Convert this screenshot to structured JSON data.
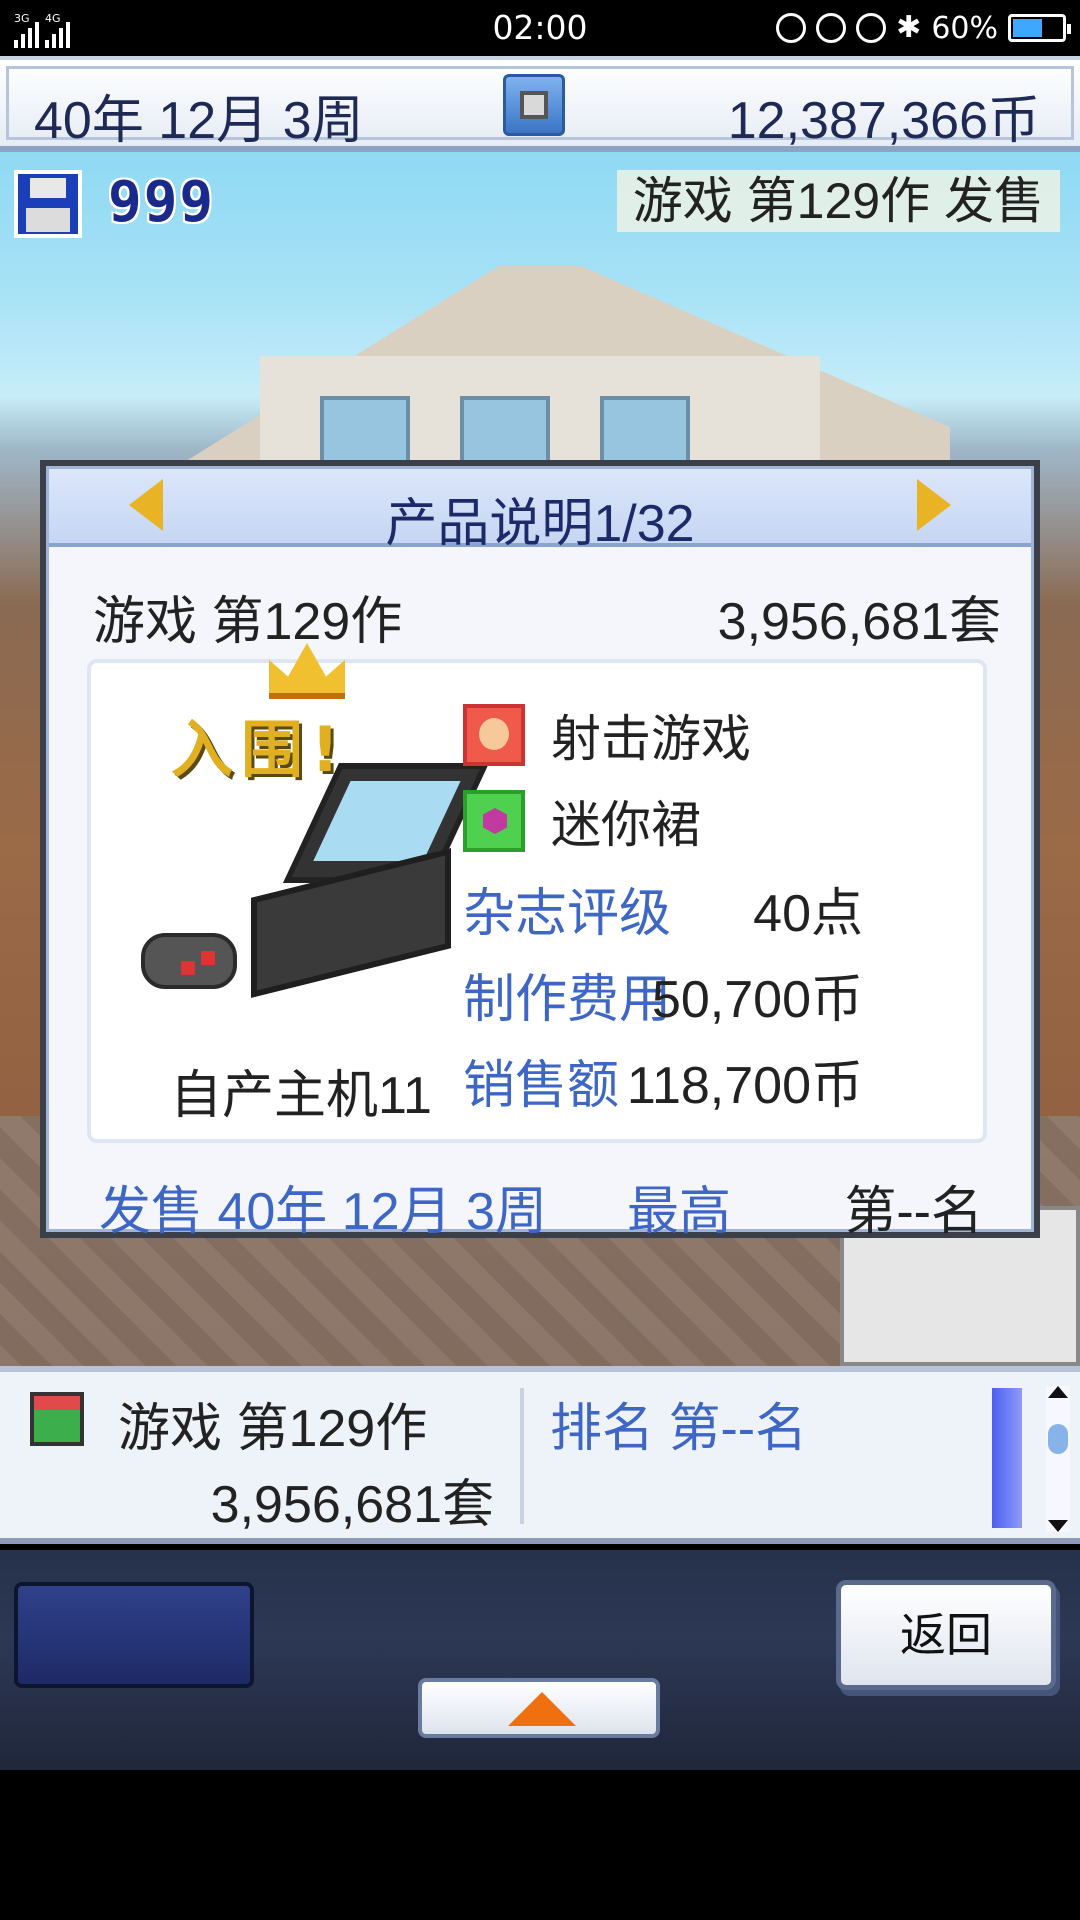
{
  "status_bar": {
    "signal1_tag": "3G",
    "signal2_tag": "4G",
    "time": "02:00",
    "battery_text": "60%",
    "battery_level": 0.6,
    "icons": [
      "mute-icon",
      "rotation-lock-icon",
      "alarm-icon",
      "bluetooth-icon",
      "battery-icon"
    ]
  },
  "topbar": {
    "date": "40年 12月 3周",
    "money": "12,387,366币",
    "speed_icon": "speed-toggle-icon"
  },
  "save": {
    "icon": "floppy-disk-icon",
    "count": "999"
  },
  "ticker": {
    "text": "游戏 第129作 发售"
  },
  "dialog": {
    "title": "产品说明1/32",
    "prev_icon": "arrow-left-icon",
    "next_icon": "arrow-right-icon",
    "game_name": "游戏 第129作",
    "units": "3,956,681套",
    "badge": "入围!",
    "platform": "自产主机11",
    "genre": "射击游戏",
    "theme": "迷你裙",
    "stats": [
      {
        "label": "杂志评级",
        "value": "40点"
      },
      {
        "label": "制作费用",
        "value": "50,700币"
      },
      {
        "label": "销售额",
        "value": "118,700币"
      }
    ],
    "release": "发售 40年 12月 3周",
    "best_label": "最高",
    "best_value": "第--名"
  },
  "list": {
    "name": "游戏 第129作",
    "units": "3,956,681套",
    "rank": "排名 第--名"
  },
  "controls": {
    "back_label": "返回",
    "up_icon": "arrow-up-icon"
  },
  "colors": {
    "label_blue": "#3d66c5",
    "title_navy": "#1c2a6a",
    "arrow_gold": "#e8b425",
    "up_orange": "#f07010"
  }
}
